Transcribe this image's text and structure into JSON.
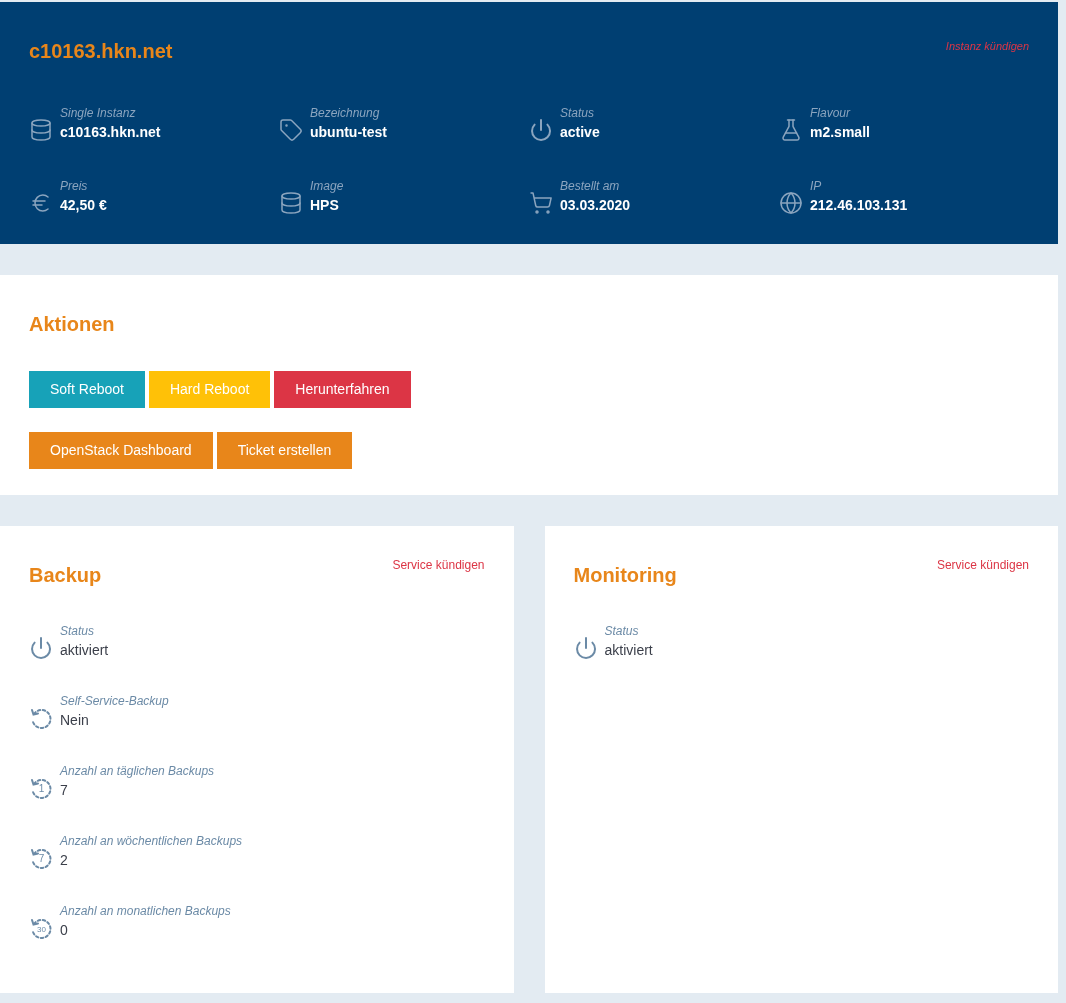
{
  "header": {
    "title": "c10163.hkn.net",
    "cancel_link": "Instanz kündigen",
    "fields": [
      {
        "kind": "database",
        "label": "Single Instanz",
        "value": "c10163.hkn.net"
      },
      {
        "kind": "tag",
        "label": "Bezeichnung",
        "value": "ubuntu-test"
      },
      {
        "kind": "power",
        "label": "Status",
        "value": "active"
      },
      {
        "kind": "flask",
        "label": "Flavour",
        "value": "m2.small"
      },
      {
        "kind": "euro",
        "label": "Preis",
        "value": "42,50 €"
      },
      {
        "kind": "database",
        "label": "Image",
        "value": "HPS"
      },
      {
        "kind": "cart",
        "label": "Bestellt am",
        "value": "03.03.2020"
      },
      {
        "kind": "globe",
        "label": "IP",
        "value": "212.46.103.131"
      }
    ]
  },
  "actions": {
    "title": "Aktionen",
    "button_rows": [
      [
        {
          "label": "Soft Reboot",
          "color": "#17a2b8"
        },
        {
          "label": "Hard Reboot",
          "color": "#ffc107"
        },
        {
          "label": "Herunterfahren",
          "color": "#dc3545"
        }
      ],
      [
        {
          "label": "OpenStack Dashboard",
          "color": "#e8861a"
        },
        {
          "label": "Ticket erstellen",
          "color": "#e8861a"
        }
      ]
    ]
  },
  "services": [
    {
      "title": "Backup",
      "cancel_link": "Service kündigen",
      "fields": [
        {
          "kind": "power",
          "label": "Status",
          "value": "aktiviert"
        },
        {
          "kind": "history",
          "label": "Self-Service-Backup",
          "value": "Nein"
        },
        {
          "kind": "history",
          "icon_label": "1",
          "label": "Anzahl an täglichen Backups",
          "value": "7"
        },
        {
          "kind": "history",
          "icon_label": "7",
          "label": "Anzahl an wöchentlichen Backups",
          "value": "2"
        },
        {
          "kind": "history",
          "icon_label": "30",
          "label": "Anzahl an monatlichen Backups",
          "value": "0"
        }
      ]
    },
    {
      "title": "Monitoring",
      "cancel_link": "Service kündigen",
      "fields": [
        {
          "kind": "power",
          "label": "Status",
          "value": "aktiviert"
        }
      ]
    }
  ]
}
